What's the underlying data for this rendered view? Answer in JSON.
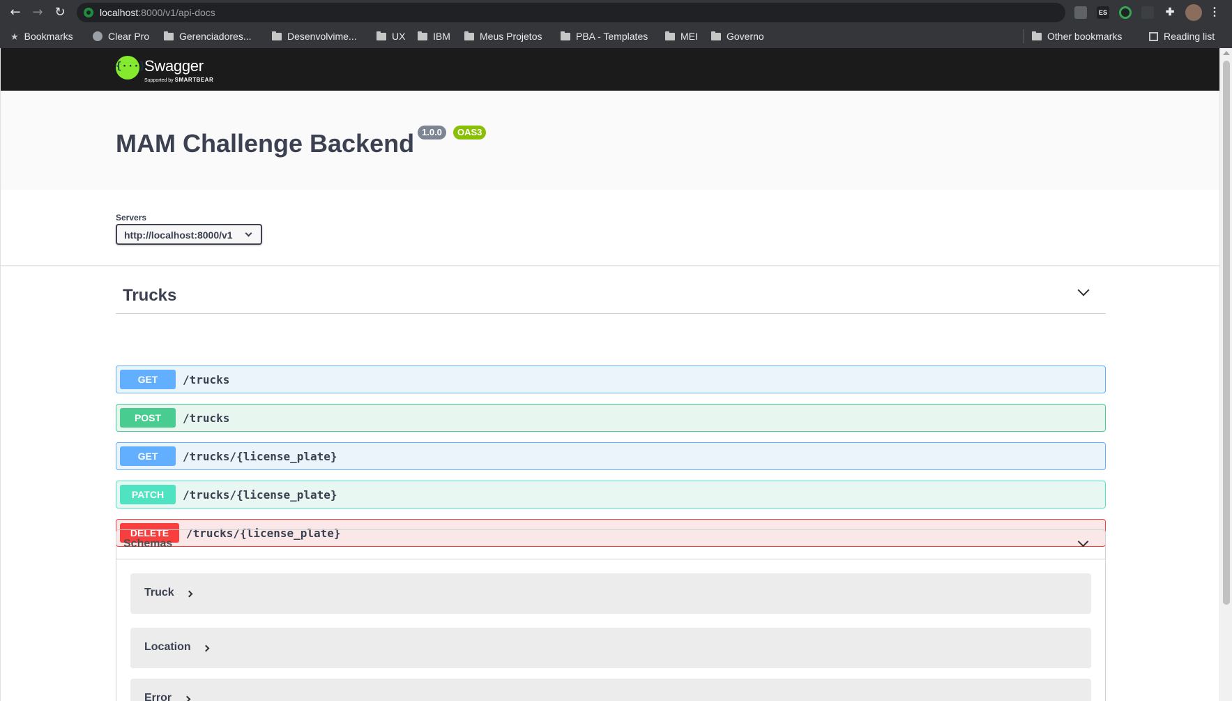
{
  "browser": {
    "url_host": "localhost",
    "url_path": ":8000/v1/api-docs",
    "extensions": [
      "ES"
    ],
    "bookmarks": [
      {
        "label": "Bookmarks",
        "icon": "star-icon"
      },
      {
        "label": "Clear Pro",
        "icon": "globe-icon"
      },
      {
        "label": "Gerenciadores...",
        "icon": "folder-icon"
      },
      {
        "label": "Desenvolvime...",
        "icon": "folder-icon"
      },
      {
        "label": "UX",
        "icon": "folder-icon"
      },
      {
        "label": "IBM",
        "icon": "folder-icon"
      },
      {
        "label": "Meus Projetos",
        "icon": "folder-icon"
      },
      {
        "label": "PBA - Templates",
        "icon": "folder-icon"
      },
      {
        "label": "MEI",
        "icon": "folder-icon"
      },
      {
        "label": "Governo",
        "icon": "folder-icon"
      }
    ],
    "other_bookmarks": "Other bookmarks",
    "reading_list": "Reading list"
  },
  "swagger": {
    "brand": "Swagger",
    "supported_by": "Supported by",
    "smartbear": "SMARTBEAR"
  },
  "info": {
    "title": "MAM Challenge Backend",
    "version": "1.0.0",
    "oas": "OAS3"
  },
  "servers": {
    "label": "Servers",
    "selected": "http://localhost:8000/v1"
  },
  "tag": {
    "name": "Trucks",
    "operations": [
      {
        "method": "GET",
        "path": "/trucks"
      },
      {
        "method": "POST",
        "path": "/trucks"
      },
      {
        "method": "GET",
        "path": "/trucks/{license_plate}"
      },
      {
        "method": "PATCH",
        "path": "/trucks/{license_plate}"
      },
      {
        "method": "DELETE",
        "path": "/trucks/{license_plate}"
      }
    ]
  },
  "schemas": {
    "title": "Schemas",
    "models": [
      "Truck",
      "Location",
      "Error"
    ]
  },
  "colors": {
    "get": "#61affe",
    "post": "#49cc90",
    "patch": "#50e3c2",
    "delete": "#f93e3e",
    "swagger_green": "#85ea2d",
    "topbar": "#1b1b1b"
  }
}
